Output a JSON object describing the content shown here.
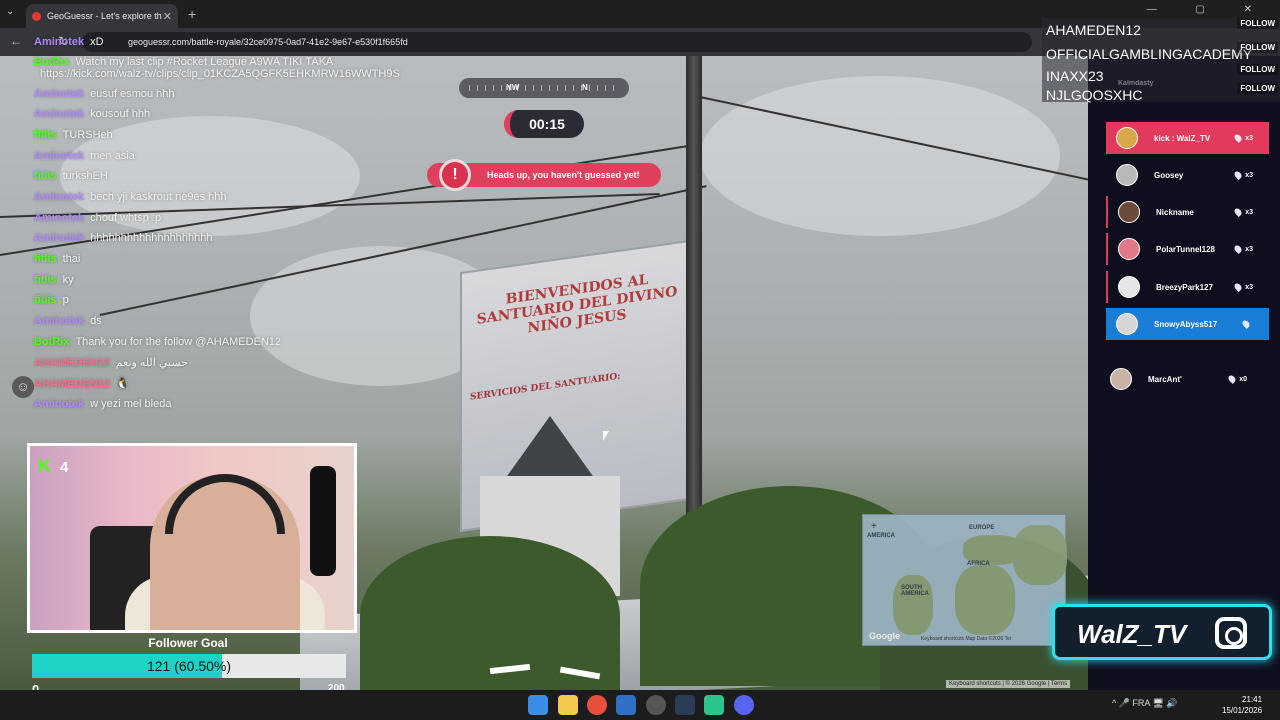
{
  "browser": {
    "tab_title": "GeoGuessr - Let's explore th",
    "tab_close": "✕",
    "new_tab": "+",
    "url": "geoguessr.com/battle-royale/32ce0975-0ad7-41e2-9e67-e530f1f665fd",
    "window_controls": "— ▢ ✕"
  },
  "game": {
    "compass": {
      "left": "NW",
      "right": "N"
    },
    "timer": "00:15",
    "alert": "Heads up, you haven't guessed yet!",
    "alert_icon": "!",
    "billboard_title": "BIENVENIDOS AL SANTUARIO DEL DIVINO NIÑO JESUS",
    "billboard_sub": "SERVICIOS DEL SANTUARIO:",
    "minimap": {
      "labels": [
        "EUROPE",
        "AFRICA",
        "SOUTH AMERICA",
        "AMERICA"
      ],
      "google": "Google",
      "footer": "Keyboard shortcuts   Map Data ©2026   Ter",
      "plus": "+"
    },
    "street_footer": "Keyboard shortcuts | © 2026 Google | Terms"
  },
  "chat": [
    {
      "user": "Aminotek",
      "color": "#b388ff",
      "msg": "xD"
    },
    {
      "user": "BotRix",
      "color": "#53fc18",
      "msg": "Watch my last clip #Rocket League A9WA TIKI TAKA"
    },
    {
      "user": "",
      "color": "#ffffff",
      "msg": "https://kick.com/walz-tv/clips/clip_01KCZA5QGFK5EHKMRW16WWTH9S"
    },
    {
      "user": "Aminotek",
      "color": "#b388ff",
      "msg": "eusuf esmou hhh"
    },
    {
      "user": "Aminotek",
      "color": "#b388ff",
      "msg": "kousouf hhh"
    },
    {
      "user": "fitlis",
      "color": "#53fc18",
      "msg": "TURSHeh"
    },
    {
      "user": "Aminotek",
      "color": "#b388ff",
      "msg": "men asia"
    },
    {
      "user": "fitlis",
      "color": "#53fc18",
      "msg": "turkshEH"
    },
    {
      "user": "Aminotek",
      "color": "#b388ff",
      "msg": "bech yji kaskrout ne9es hhh"
    },
    {
      "user": "Aminotek",
      "color": "#b388ff",
      "msg": "chouf whtsp :p"
    },
    {
      "user": "Aminotek",
      "color": "#b388ff",
      "msg": "hhhhhhhhhhhhhhhhhhhh"
    },
    {
      "user": "fitlis",
      "color": "#53fc18",
      "msg": "thai"
    },
    {
      "user": "fitlis",
      "color": "#53fc18",
      "msg": "ky"
    },
    {
      "user": "fitlis",
      "color": "#53fc18",
      "msg": "p"
    },
    {
      "user": "Aminotek",
      "color": "#b388ff",
      "msg": "ds"
    },
    {
      "user": "BotRix",
      "color": "#53fc18",
      "msg": "Thank you for the follow @AHAMEDEN12"
    },
    {
      "user": "AHAMEDEN12",
      "color": "#ff6b8a",
      "msg": "حسبي الله ونعم"
    },
    {
      "user": "AHAMEDEN12",
      "color": "#ff6b8a",
      "msg": "🐧"
    },
    {
      "user": "Aminotek",
      "color": "#b388ff",
      "msg": "w yezi mel bleda"
    }
  ],
  "emoji_button": "☺",
  "webcam": {
    "platform_icon": "K",
    "viewers": "4"
  },
  "goal": {
    "title": "Follower Goal",
    "text": "121 (60.50%)",
    "fraction": 0.605,
    "min": "0",
    "max": "200"
  },
  "follows": [
    {
      "name": "AHAMEDEN12",
      "button": "FOLLOW"
    },
    {
      "name": "OFFICIALGAMBLINGACADEMY",
      "button": "FOLLOW"
    },
    {
      "name": "INAXX23",
      "button": "FOLLOW"
    },
    {
      "name": "NJLGQOSXHC",
      "button": "FOLLOW"
    }
  ],
  "faded_player": "Kalmdasty",
  "players": [
    {
      "name": "kick : WalZ_TV",
      "lives": "x3",
      "style": "hl-red",
      "avatar": "#d9a74a"
    },
    {
      "name": "Goosey",
      "lives": "x3",
      "style": "",
      "avatar": "#b9b9b9"
    },
    {
      "name": "Nickname",
      "lives": "x3",
      "style": "bordered",
      "avatar": "#6b4a3a"
    },
    {
      "name": "PolarTunnel128",
      "lives": "x3",
      "style": "bordered",
      "avatar": "#e07a8a"
    },
    {
      "name": "BreezyPark127",
      "lives": "x3",
      "style": "bordered",
      "avatar": "#e6e6e6"
    },
    {
      "name": "SnowyAbyss517",
      "lives": "",
      "style": "hl-blue",
      "avatar": "#d6d6d6"
    }
  ],
  "eliminated_player": {
    "name": "MarcAnt'",
    "lives": "x0"
  },
  "brand": {
    "name": "WalZ_TV"
  },
  "taskbar": {
    "tray": "^   🎤   FRA   🖥   🔊",
    "time": "21:41",
    "date": "15/01/2026"
  }
}
